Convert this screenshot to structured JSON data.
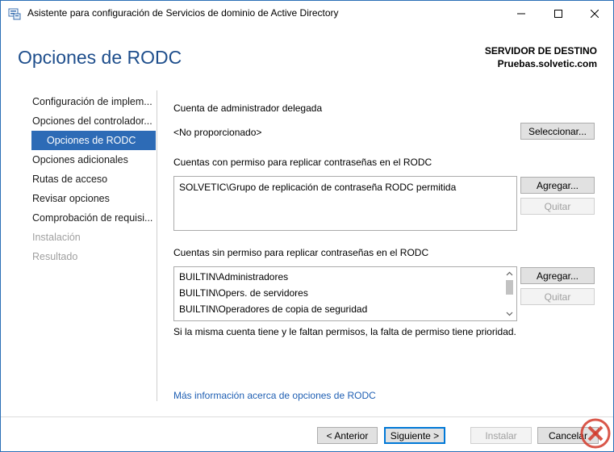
{
  "window": {
    "title": "Asistente para configuración de Servicios de dominio de Active Directory",
    "icon": "server-manager-icon",
    "controls": {
      "minimize": "minimize-icon",
      "maximize": "maximize-icon",
      "close": "close-icon"
    }
  },
  "header": {
    "title": "Opciones de RODC",
    "destination_label": "SERVIDOR DE DESTINO",
    "destination_value": "Pruebas.solvetic.com"
  },
  "nav": {
    "items": [
      {
        "label": "Configuración de implem...",
        "state": "normal"
      },
      {
        "label": "Opciones del controlador...",
        "state": "normal"
      },
      {
        "label": "Opciones de RODC",
        "state": "selected"
      },
      {
        "label": "Opciones adicionales",
        "state": "normal"
      },
      {
        "label": "Rutas de acceso",
        "state": "normal"
      },
      {
        "label": "Revisar opciones",
        "state": "normal"
      },
      {
        "label": "Comprobación de requisi...",
        "state": "normal"
      },
      {
        "label": "Instalación",
        "state": "disabled"
      },
      {
        "label": "Resultado",
        "state": "disabled"
      }
    ]
  },
  "content": {
    "delegated": {
      "label": "Cuenta de administrador delegada",
      "value": "<No proporcionado>",
      "select_button": "Seleccionar..."
    },
    "allowed": {
      "label": "Cuentas con permiso para replicar contraseñas en el RODC",
      "items": [
        "SOLVETIC\\Grupo de replicación de contraseña RODC permitida"
      ],
      "add_button": "Agregar...",
      "remove_button": "Quitar"
    },
    "denied": {
      "label": "Cuentas sin permiso para replicar contraseñas en el RODC",
      "items": [
        "BUILTIN\\Administradores",
        "BUILTIN\\Opers. de servidores",
        "BUILTIN\\Operadores de copia de seguridad"
      ],
      "add_button": "Agregar...",
      "remove_button": "Quitar"
    },
    "note": "Si la misma cuenta tiene y le faltan permisos, la falta de permiso tiene prioridad.",
    "more_info_link": "Más información acerca de opciones de RODC"
  },
  "footer": {
    "back": "< Anterior",
    "next": "Siguiente >",
    "install": "Instalar",
    "cancel": "Cancelar"
  },
  "colors": {
    "accent": "#2d6bb6",
    "title_blue": "#1e4e8c",
    "link": "#1f5fb3"
  }
}
